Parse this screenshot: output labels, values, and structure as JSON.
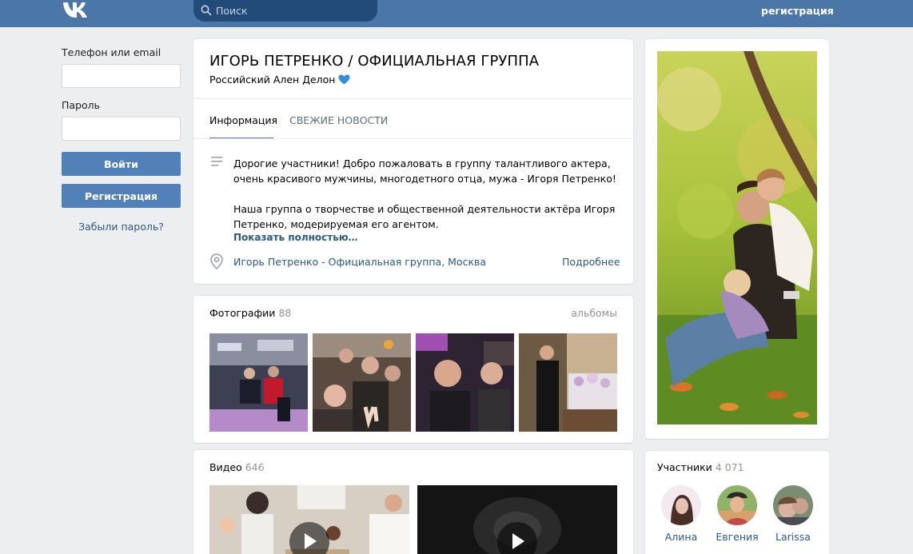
{
  "header": {
    "logo_icon": "vk-logo-icon",
    "search_placeholder": "Поиск",
    "register_link": "регистрация"
  },
  "login": {
    "phone_label": "Телефон или email",
    "phone_value": "",
    "password_label": "Пароль",
    "password_value": "",
    "login_button": "Войти",
    "register_button": "Регистрация",
    "forgot_link": "Забыли пароль?"
  },
  "group": {
    "title": "ИГОРЬ ПЕТРЕНКО / ОФИЦИАЛЬНАЯ ГРУППА",
    "status": "Российский Ален Делон",
    "status_icon": "blue-heart-icon",
    "tabs": [
      {
        "label": "Информация",
        "active": true
      },
      {
        "label": "СВЕЖИЕ НОВОСТИ",
        "active": false
      }
    ],
    "description": [
      "Дорогие участники! Добро пожаловать в группу талантливого актера, очень красивого мужчины, многодетного отца, мужа - Игоря Петренко!",
      "Наша группа о творчестве и общественной деятельности актёра Игоря Петренко, модерируемая его агентом."
    ],
    "show_more": "Показать полностью…",
    "location": "Игорь Петренко - Официальная группа, Москва",
    "details_link": "Подробнее"
  },
  "photos": {
    "label": "Фотографии",
    "count": "88",
    "albums_link": "альбомы"
  },
  "videos": {
    "label": "Видео",
    "count": "646"
  },
  "members": {
    "label": "Участники",
    "count": "4 071",
    "items": [
      {
        "name": "Алина"
      },
      {
        "name": "Евгения"
      },
      {
        "name": "Larissa"
      }
    ]
  },
  "colors": {
    "header_bg": "#4a76a8",
    "button_bg": "#5181b8",
    "link": "#2a5885",
    "page_bg": "#edeef0"
  }
}
